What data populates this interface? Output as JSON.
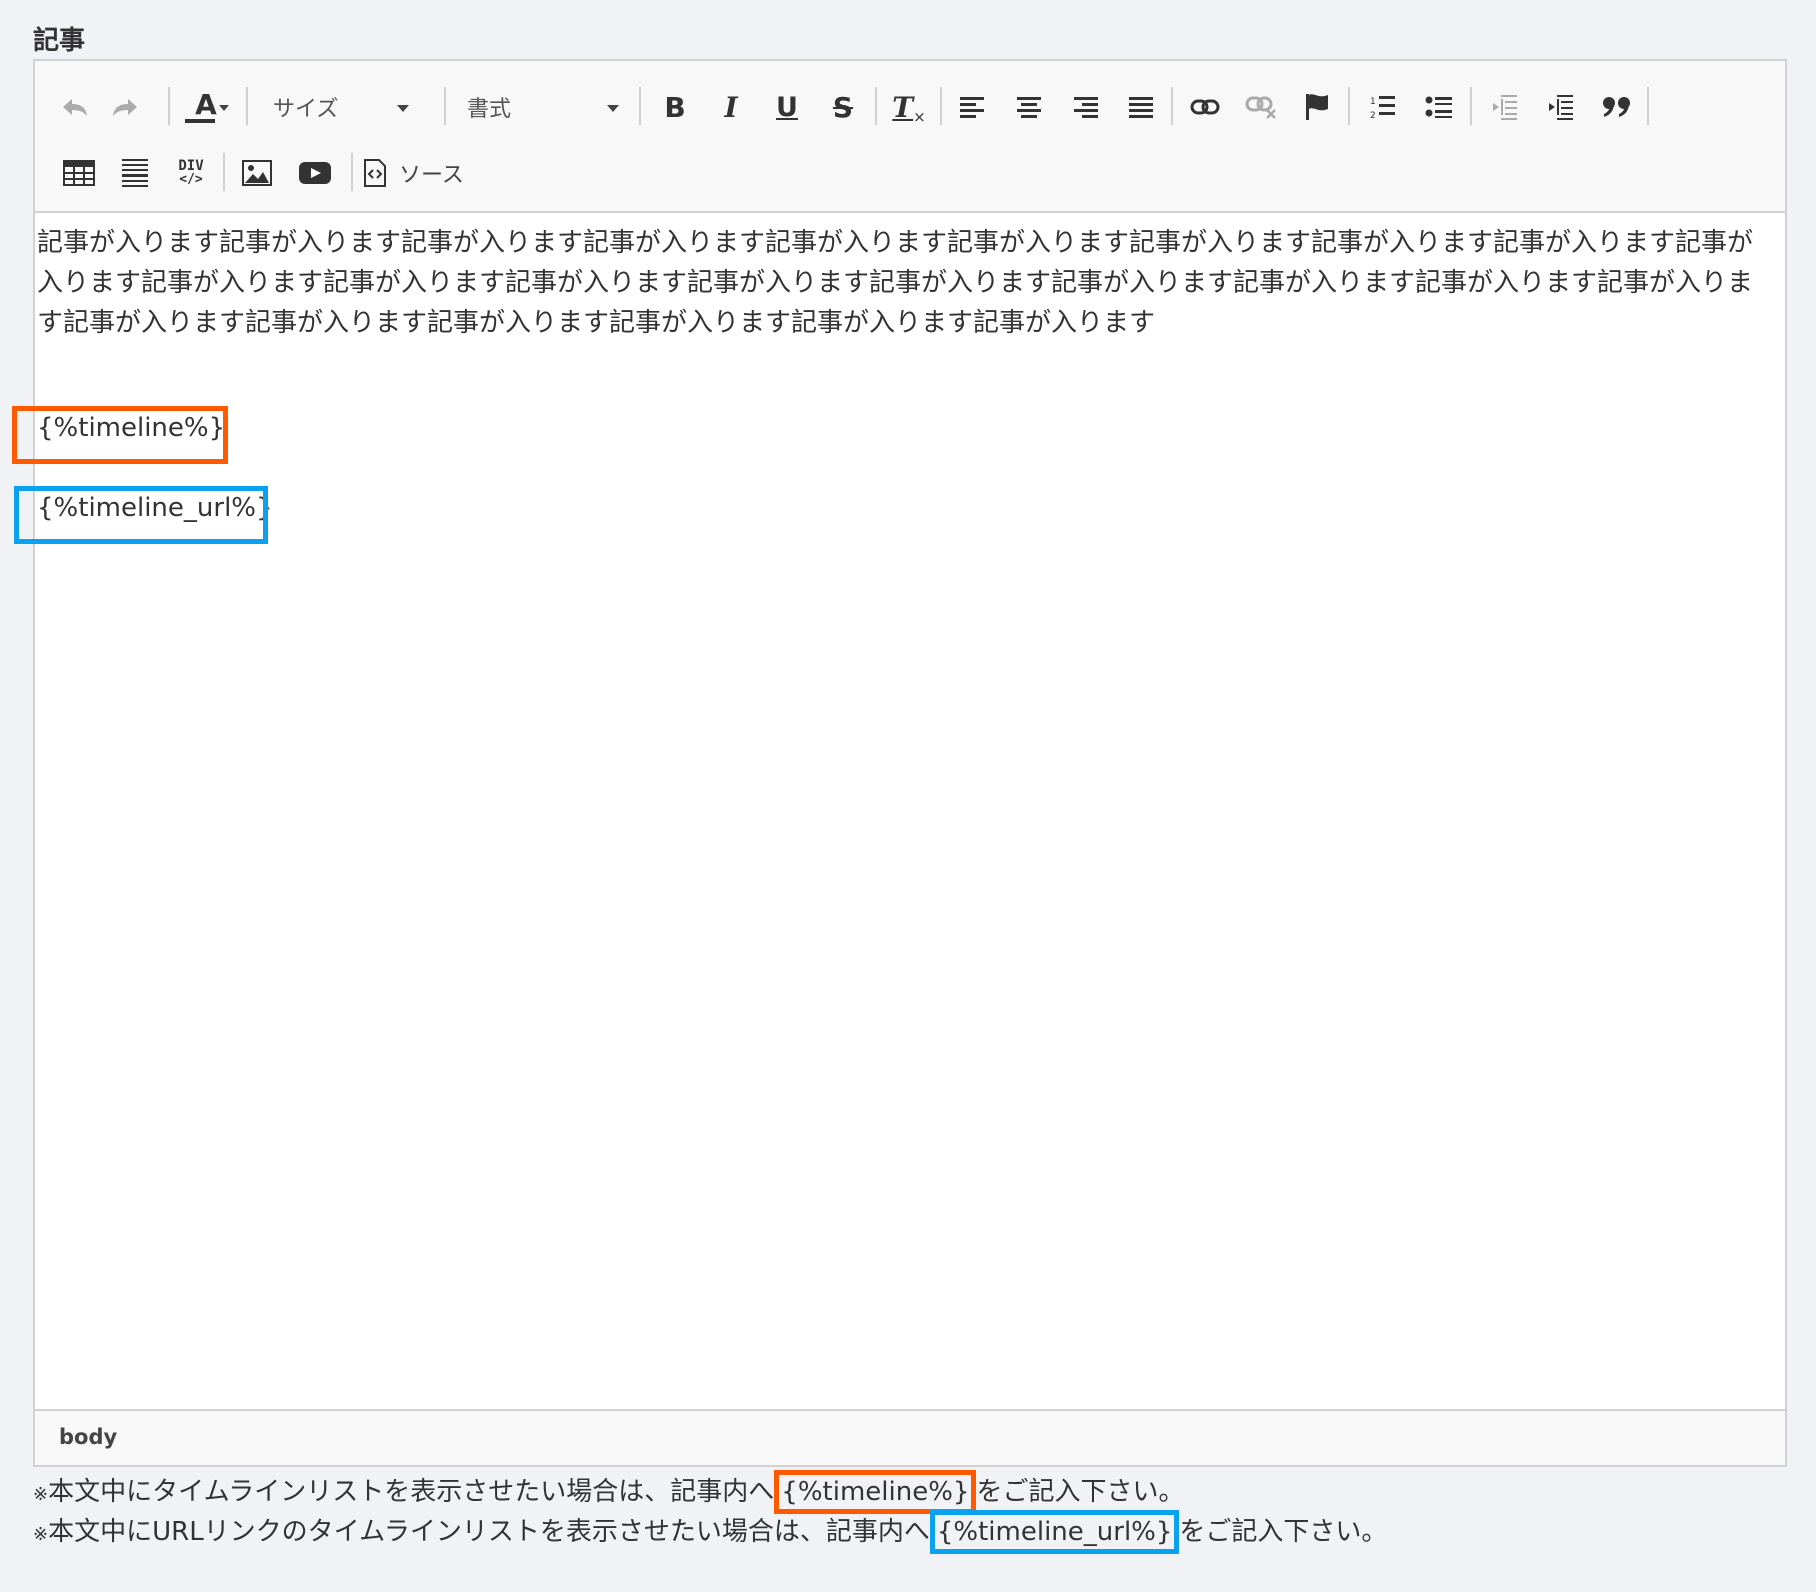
{
  "field_label": "記事",
  "toolbar": {
    "size_label": "サイズ",
    "format_label": "書式",
    "source_label": "ソース",
    "bold": "B",
    "italic": "I",
    "underline": "U",
    "strike": "S",
    "clear_format": "T",
    "text_color": "A",
    "div_label": "DIV"
  },
  "content": {
    "paragraph": "記事が入ります記事が入ります記事が入ります記事が入ります記事が入ります記事が入ります記事が入ります記事が入ります記事が入ります記事が入ります記事が入ります記事が入ります記事が入ります記事が入ります記事が入ります記事が入ります記事が入ります記事が入ります記事が入ります記事が入ります記事が入ります記事が入ります記事が入ります記事が入ります記事が入ります",
    "tag_timeline": "{%timeline%}",
    "tag_timeline_url": "{%timeline_url%}"
  },
  "statusbar": {
    "path": "body"
  },
  "notes": {
    "line1_prefix": "※",
    "line1_before": "本文中にタイムラインリストを表示させたい場合は、記事内へ",
    "line1_tag": "{%timeline%}",
    "line1_after": "をご記入下さい。",
    "line2_prefix": "※",
    "line2_before": "本文中にURLリンクのタイムラインリストを表示させたい場合は、記事内へ",
    "line2_tag": "{%timeline_url%}",
    "line2_after": "をご記入下さい。"
  },
  "colors": {
    "highlight_orange": "#ff5a00",
    "highlight_blue": "#0aa1f0",
    "background": "#f1f2f6"
  }
}
